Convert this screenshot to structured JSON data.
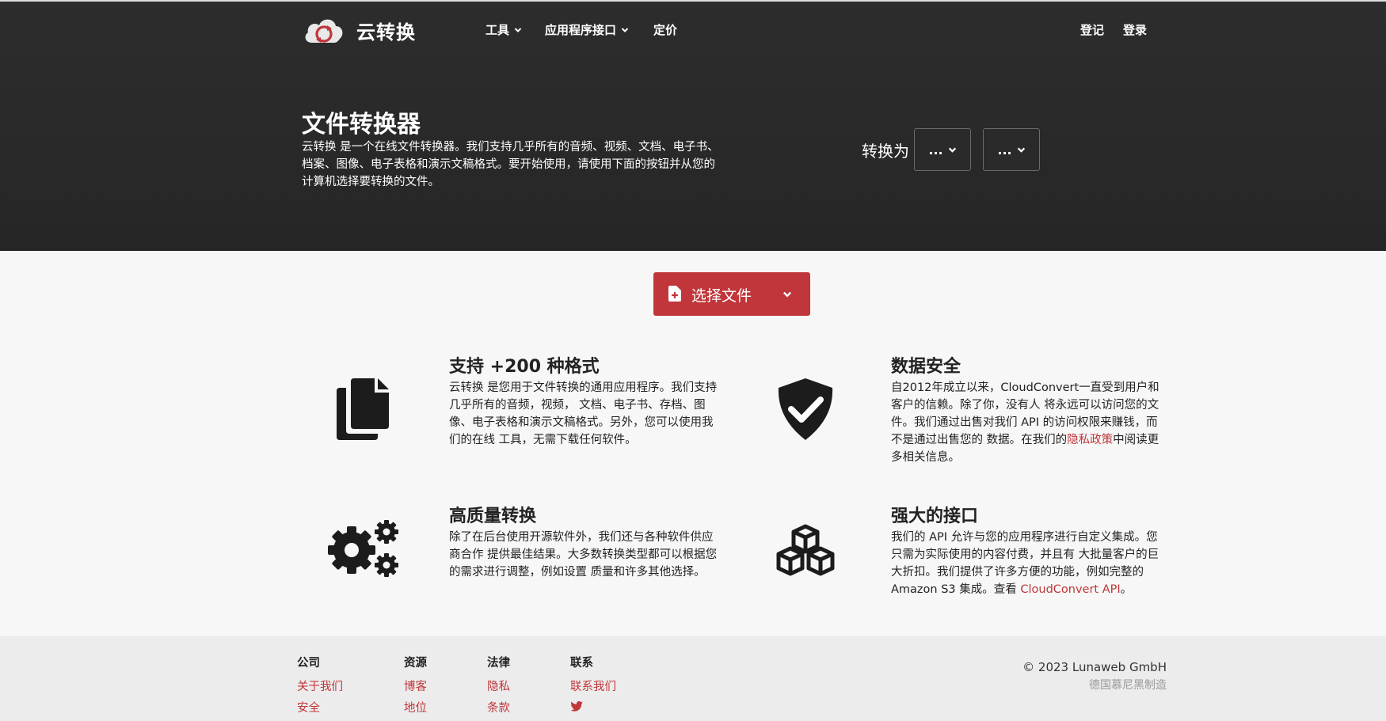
{
  "header": {
    "logo_text": "云转换",
    "nav": {
      "tools": "工具",
      "api": "应用程序接口",
      "pricing": "定价",
      "register": "登记",
      "login": "登录"
    }
  },
  "hero": {
    "title": "文件转换器",
    "description": "云转换 是一个在线文件转换器。我们支持几乎所有的音频、视频、文档、电子书、档案、图像、电子表格和演示文稿格式。要开始使用，请使用下面的按钮并从您的计算机选择要转换的文件。",
    "convert_label": "转换为",
    "from_value": "...",
    "to_value": "..."
  },
  "select_file": {
    "label": "选择文件"
  },
  "features": {
    "formats": {
      "title": "支持 +200 种格式",
      "text": "云转换 是您用于文件转换的通用应用程序。我们支持几乎所有的音频，视频， 文档、电子书、存档、图像、电子表格和演示文稿格式。另外，您可以使用我们的在线 工具，无需下载任何软件。"
    },
    "security": {
      "title": "数据安全",
      "text_before": "自2012年成立以来，CloudConvert一直受到用户和客户的信赖。除了你，没有人 将永远可以访问您的文件。我们通过出售对我们 API 的访问权限来赚钱，而不是通过出售您的 数据。在我们的",
      "link": "隐私政策",
      "text_after": "中阅读更多相关信息。"
    },
    "quality": {
      "title": "高质量转换",
      "text": "除了在后台使用开源软件外，我们还与各种软件供应商合作 提供最佳结果。大多数转换类型都可以根据您的需求进行调整，例如设置 质量和许多其他选择。"
    },
    "api": {
      "title": "强大的接口",
      "text_before": "我们的 API 允许与您的应用程序进行自定义集成。您只需为实际使用的内容付费，并且有 大批量客户的巨大折扣。我们提供了许多方便的功能，例如完整的Amazon S3 集成。查看 ",
      "link": "CloudConvert API",
      "text_after": "。"
    }
  },
  "footer": {
    "company": {
      "heading": "公司",
      "links": [
        "关于我们",
        "安全"
      ]
    },
    "resources": {
      "heading": "资源",
      "links": [
        "博客",
        "地位"
      ]
    },
    "legal": {
      "heading": "法律",
      "links": [
        "隐私",
        "条款"
      ]
    },
    "contact": {
      "heading": "联系",
      "links": [
        "联系我们"
      ],
      "social_icon": "twitter-icon"
    },
    "copyright": "© 2023 Lunaweb GmbH",
    "made_in": "德国慕尼黑制造"
  },
  "colors": {
    "hero_bg": "#2a2a2a",
    "accent_red": "#c0363a",
    "page_bg": "#f7f7f7",
    "footer_bg": "#ececec"
  }
}
